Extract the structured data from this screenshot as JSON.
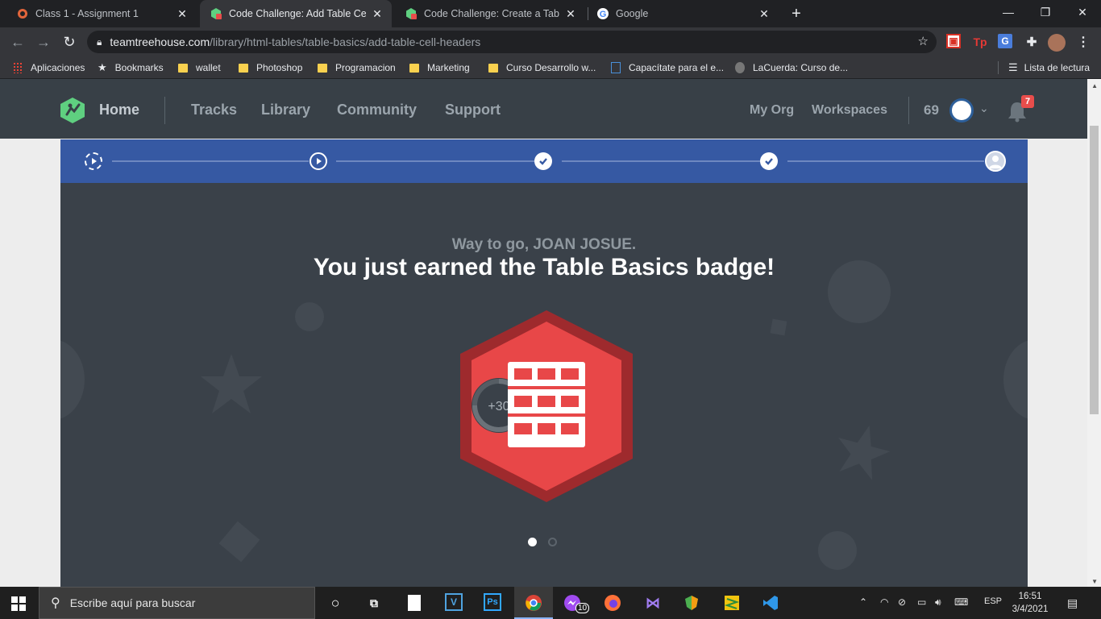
{
  "browser": {
    "tabs": [
      {
        "title": "Class 1 - Assignment 1",
        "active": false
      },
      {
        "title": "Code Challenge: Add Table Cell H",
        "active": true
      },
      {
        "title": "Code Challenge: Create a Table",
        "active": false
      },
      {
        "title": "Google",
        "active": false
      }
    ],
    "new_tab": "+",
    "url_host": "teamtreehouse.com",
    "url_path": "/library/html-tables/table-basics/add-table-cell-headers"
  },
  "bookmarks": [
    {
      "label": "Aplicaciones"
    },
    {
      "label": "Bookmarks"
    },
    {
      "label": "wallet"
    },
    {
      "label": "Photoshop"
    },
    {
      "label": "Programacion"
    },
    {
      "label": "Marketing"
    },
    {
      "label": "Curso Desarrollo w..."
    },
    {
      "label": "Capacítate para el e..."
    },
    {
      "label": "LaCuerda: Curso de..."
    }
  ],
  "reading_list": "Lista de lectura",
  "site_nav": {
    "home": "Home",
    "tracks": "Tracks",
    "library": "Library",
    "community": "Community",
    "support": "Support",
    "my_org": "My Org",
    "workspaces": "Workspaces",
    "points": "69",
    "notifications": "7"
  },
  "progress_steps": [
    {
      "state": "dashed-play"
    },
    {
      "state": "play"
    },
    {
      "state": "done"
    },
    {
      "state": "done"
    },
    {
      "state": "current-user"
    }
  ],
  "earned": {
    "greeting": "Way to go, JOAN JOSUE.",
    "headline": "You just earned the Table Basics badge!",
    "points_award": "+30"
  },
  "carousel": {
    "pages": 2,
    "active": 1
  },
  "taskbar": {
    "search_placeholder": "Escribe aquí para buscar",
    "messenger_count": "10",
    "language": "ESP",
    "time": "16:51",
    "date": "3/4/2021"
  },
  "colors": {
    "nav_bg": "#384047",
    "progress_bg": "#3659a3",
    "stage_bg": "#3a4149",
    "badge_red": "#e84748",
    "badge_dark_red": "#9e2a2d",
    "treehouse_green": "#5fcf80"
  }
}
